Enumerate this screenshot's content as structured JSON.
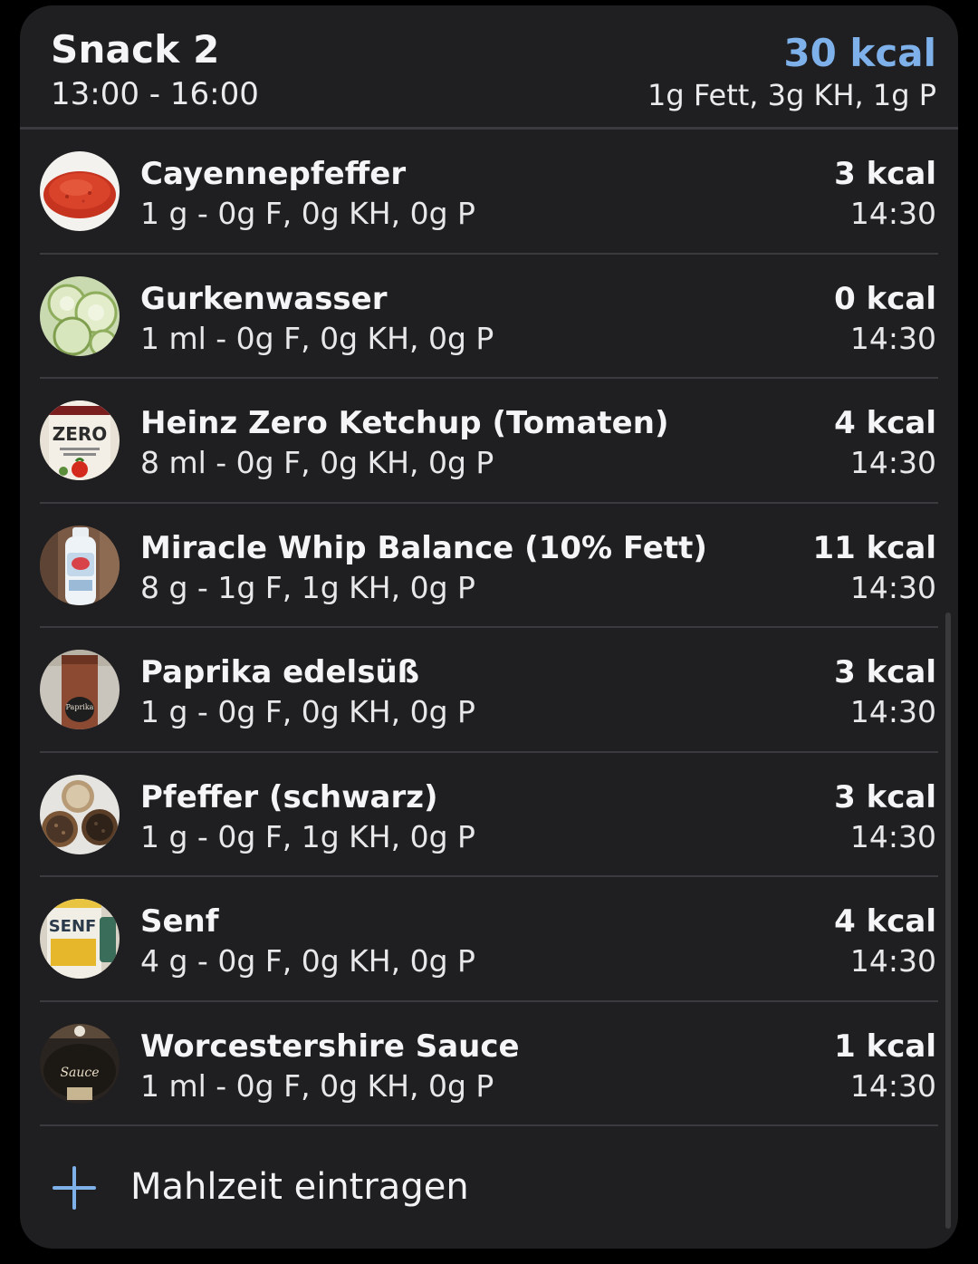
{
  "meal": {
    "title": "Snack 2",
    "time_range": "13:00 - 16:00",
    "total_kcal": "30 kcal",
    "macros": "1g Fett, 3g KH, 1g P",
    "accent_color": "#7eb0ea"
  },
  "items": [
    {
      "name": "Cayennepfeffer",
      "detail": "1 g - 0g F, 0g KH, 0g P",
      "kcal": "3 kcal",
      "time": "14:30",
      "icon": "cayenne-pepper-photo"
    },
    {
      "name": "Gurkenwasser",
      "detail": "1 ml - 0g F, 0g KH, 0g P",
      "kcal": "0 kcal",
      "time": "14:30",
      "icon": "cucumber-water-photo"
    },
    {
      "name": "Heinz Zero Ketchup (Tomaten)",
      "detail": "8 ml - 0g F, 0g KH, 0g P",
      "kcal": "4 kcal",
      "time": "14:30",
      "icon": "ketchup-bottle-photo"
    },
    {
      "name": "Miracle Whip Balance (10% Fett)",
      "detail": "8 g - 1g F, 1g KH, 0g P",
      "kcal": "11 kcal",
      "time": "14:30",
      "icon": "miracle-whip-bottle-photo"
    },
    {
      "name": "Paprika edelsüß",
      "detail": "1 g - 0g F, 0g KH, 0g P",
      "kcal": "3 kcal",
      "time": "14:30",
      "icon": "paprika-jar-photo"
    },
    {
      "name": "Pfeffer (schwarz)",
      "detail": "1 g - 0g F, 1g KH, 0g P",
      "kcal": "3 kcal",
      "time": "14:30",
      "icon": "peppercorn-bowls-photo"
    },
    {
      "name": "Senf",
      "detail": "4 g - 0g F, 0g KH, 0g P",
      "kcal": "4 kcal",
      "time": "14:30",
      "icon": "mustard-jar-photo"
    },
    {
      "name": "Worcestershire Sauce",
      "detail": "1 ml - 0g F, 0g KH, 0g P",
      "kcal": "1 kcal",
      "time": "14:30",
      "icon": "worcestershire-bottle-photo"
    }
  ],
  "thumb_text": {
    "ketchup": "ZERO",
    "paprika": "Paprika",
    "senf": "SENF",
    "worcester": "Sauce"
  },
  "add": {
    "label": "Mahlzeit eintragen",
    "icon": "plus-icon"
  }
}
